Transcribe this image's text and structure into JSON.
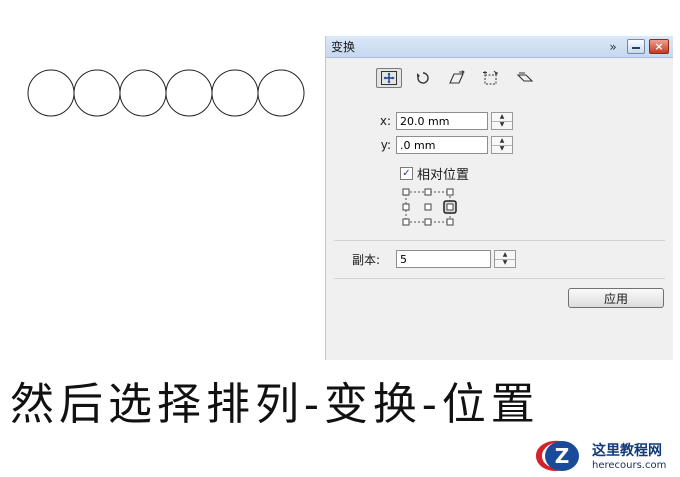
{
  "panel": {
    "title": "变换",
    "expand_glyph": "»",
    "close_glyph": "×",
    "tools": [
      {
        "name": "position",
        "icon": "position-icon",
        "active": true
      },
      {
        "name": "rotate",
        "icon": "rotate-icon",
        "active": false
      },
      {
        "name": "scale-mirror",
        "icon": "scale-mirror-icon",
        "active": false
      },
      {
        "name": "size",
        "icon": "size-icon",
        "active": false
      },
      {
        "name": "skew",
        "icon": "skew-icon",
        "active": false
      }
    ],
    "x": {
      "label": "x:",
      "value": "20.0 mm"
    },
    "y": {
      "label": "y:",
      "value": ".0 mm"
    },
    "relative_position": {
      "label": "相对位置",
      "checked": true,
      "check_glyph": "✓"
    },
    "copies": {
      "label": "副本:",
      "value": "5"
    },
    "apply_label": "应用"
  },
  "canvas": {
    "circle_count": 6
  },
  "caption": "然后选择排列-变换-位置",
  "watermark": {
    "logo_letter": "Z",
    "name": "这里教程网",
    "url": "herecours.com"
  },
  "colors": {
    "panel_bg": "#f0f0f0",
    "header_bg": "#c5d8ef",
    "close_red": "#c33a22",
    "checkmark_blue": "#1e3a8a",
    "logo_blue": "#1a4a9a",
    "logo_red": "#d4232b"
  }
}
